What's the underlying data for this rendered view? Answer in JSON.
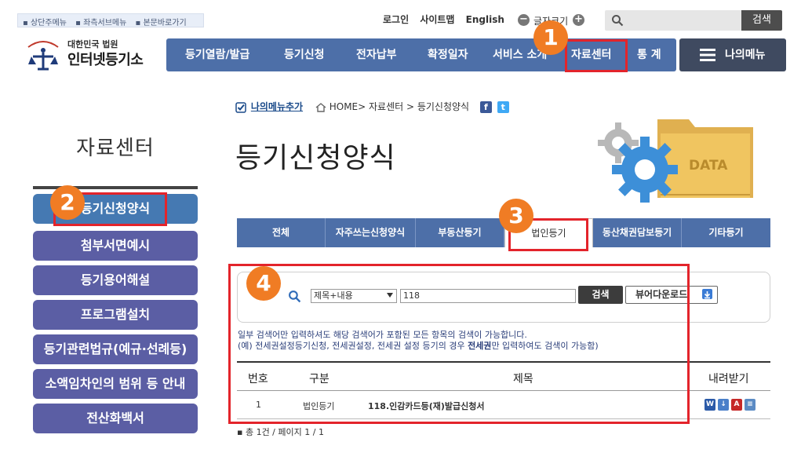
{
  "skip_links": [
    "상단주메뉴",
    "좌측서브메뉴",
    "본문바로가기"
  ],
  "util": {
    "login": "로그인",
    "sitemap": "사이트맵",
    "english": "English",
    "font_label": "글자크기"
  },
  "search_top": {
    "button": "검색"
  },
  "logo": {
    "line1": "대한민국 법원",
    "line2": "인터넷등기소"
  },
  "gnb": [
    "등기열람/발급",
    "등기신청",
    "전자납부",
    "확정일자",
    "서비스 소개",
    "자료센터",
    "통 계"
  ],
  "my_menu": "나의메뉴",
  "lnb": {
    "title": "자료센터",
    "items": [
      "등기신청양식",
      "첨부서면예시",
      "등기용어해설",
      "프로그램설치",
      "등기관련법규(예규·선례등)",
      "소액임차인의 범위 등 안내",
      "전산화백서"
    ]
  },
  "breadcrumb": {
    "add_fav": "나의메뉴추가",
    "path": "HOME> 자료센터 > 등기신청양식"
  },
  "page_title": "등기신청양식",
  "banner_text": "DATA",
  "tabs": [
    "전체",
    "자주쓰는신청양식",
    "부동산등기",
    "법인등기",
    "동산채권담보등기",
    "기타등기"
  ],
  "search": {
    "select_value": "제목+내용",
    "keyword": "118",
    "search_button": "검색",
    "viewer_button": "뷰어다운로드"
  },
  "note": {
    "line1": "일부 검색어만 입력하셔도 해당 검색어가 포함된 모든 항목의 검색이 가능합니다.",
    "line2_pre": "(예) 전세권설정등기신청, 전세권설정, 전세권 설정 등기의 경우 ",
    "line2_bold": "전세권",
    "line2_post": "만 입력하여도 검색이 가능함)"
  },
  "table": {
    "headers": [
      "번호",
      "구분",
      "제목",
      "내려받기"
    ],
    "rows": [
      {
        "no": "1",
        "category": "법인등기",
        "title": "118.인감카드등(재)발급신청서"
      }
    ]
  },
  "download_icons": [
    "W",
    "↓",
    "A",
    "≡"
  ],
  "pager": "총 1건 / 페이지 1 / 1",
  "badges": [
    "1",
    "2",
    "3",
    "4"
  ],
  "colors": {
    "nav_blue": "#4d6fa8",
    "lnb_purple": "#5b5ea4",
    "highlight_red": "#e3242b",
    "badge_orange": "#f07c24"
  }
}
